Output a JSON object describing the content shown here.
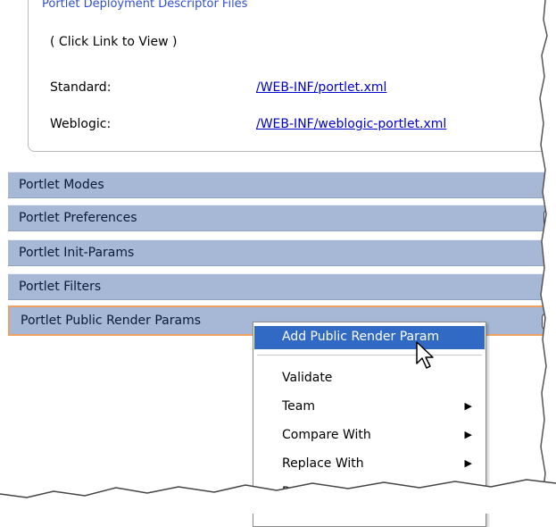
{
  "descriptor": {
    "group_title": "Portlet Deployment Descriptor Files",
    "hint": "( Click Link to View )",
    "rows": [
      {
        "label": "Standard:",
        "link": "/WEB-INF/portlet.xml"
      },
      {
        "label": "Weblogic:",
        "link": "/WEB-INF/weblogic-portlet.xml"
      }
    ]
  },
  "sections": [
    {
      "label": "Portlet Modes"
    },
    {
      "label": "Portlet Preferences"
    },
    {
      "label": "Portlet Init-Params"
    },
    {
      "label": "Portlet Filters"
    },
    {
      "label": "Portlet Public Render Params"
    }
  ],
  "context_menu": {
    "items": [
      {
        "label": "Add Public Render Param",
        "highlighted": true,
        "submenu": false
      },
      {
        "label": "Validate",
        "submenu": false
      },
      {
        "label": "Team",
        "submenu": true
      },
      {
        "label": "Compare With",
        "submenu": true
      },
      {
        "label": "Replace With",
        "submenu": true
      },
      {
        "label": "References",
        "submenu": true
      }
    ]
  },
  "colors": {
    "section_bar": "#a6b8d6",
    "menu_highlight": "#316ac5",
    "selected_border": "#f0a060",
    "link": "#0000cc"
  }
}
